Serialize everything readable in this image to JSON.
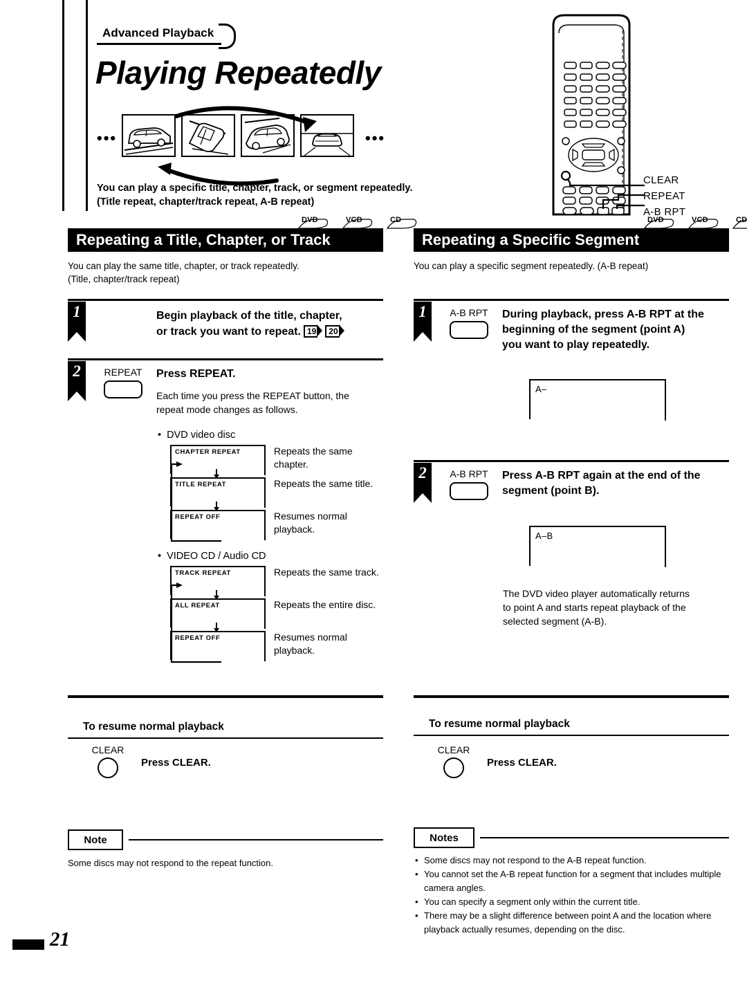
{
  "document": {
    "chapter_tab": "Advanced Playback",
    "title": "Playing Repeatedly",
    "intro_line1": "You can play a specific title, chapter, track, or segment repeatedly.",
    "intro_line2": "(Title repeat, chapter/track repeat, A-B repeat)",
    "page_number": "21"
  },
  "remote": {
    "callouts": [
      {
        "label": "CLEAR"
      },
      {
        "label": "REPEAT"
      },
      {
        "label": "A-B RPT"
      }
    ]
  },
  "media_badges": [
    "DVD",
    "VCD",
    "CD"
  ],
  "left_column": {
    "header": "Repeating a Title, Chapter, or Track",
    "sub_line1": "You can play the same title, chapter, or track repeatedly.",
    "sub_line2": "(Title, chapter/track repeat)",
    "step1": {
      "number": "1",
      "heading_line1": "Begin playback of the title, chapter,",
      "heading_line2": "or track you want to repeat.",
      "page_refs": [
        "19",
        "20"
      ]
    },
    "step2": {
      "number": "2",
      "button_caption": "REPEAT",
      "heading": "Press REPEAT.",
      "body_line1": "Each time you press the REPEAT button, the",
      "body_line2": "repeat mode changes as follows."
    },
    "flow_dvd": {
      "title": "DVD video disc",
      "rows": [
        {
          "display": "CHAPTER  REPEAT",
          "desc_line1": "Repeats the same",
          "desc_line2": "chapter."
        },
        {
          "display": "TITLE  REPEAT",
          "desc_line1": "Repeats the same title.",
          "desc_line2": ""
        },
        {
          "display": "REPEAT  OFF",
          "desc_line1": "Resumes normal",
          "desc_line2": "playback."
        }
      ]
    },
    "flow_cd": {
      "title": "VIDEO CD / Audio CD",
      "rows": [
        {
          "display": "TRACK  REPEAT",
          "desc_line1": "Repeats the same track.",
          "desc_line2": ""
        },
        {
          "display": "ALL  REPEAT",
          "desc_line1": "Repeats the entire disc.",
          "desc_line2": ""
        },
        {
          "display": "REPEAT  OFF",
          "desc_line1": "Resumes normal",
          "desc_line2": "playback."
        }
      ]
    },
    "resume": {
      "title": "To resume normal playback",
      "button_caption": "CLEAR",
      "instruction": "Press CLEAR."
    },
    "note": {
      "label": "Note",
      "text": "Some discs may not respond to the repeat function."
    }
  },
  "right_column": {
    "header": "Repeating a Specific Segment",
    "sub_line1": "You can play a specific segment repeatedly. (A-B repeat)",
    "step1": {
      "number": "1",
      "button_caption": "A-B RPT",
      "heading_line1": "During playback, press A-B RPT at the",
      "heading_line2": "beginning of the segment (point A)",
      "heading_line3": "you want to play repeatedly."
    },
    "osd_a": "A–",
    "step2": {
      "number": "2",
      "button_caption": "A-B RPT",
      "heading_line1": "Press A-B RPT again at the end of the",
      "heading_line2": "segment (point B)."
    },
    "osd_ab": "A–B",
    "after_text_line1": "The DVD video player automatically returns",
    "after_text_line2": "to point A and starts repeat playback of the",
    "after_text_line3": "selected segment (A-B).",
    "resume": {
      "title": "To resume normal playback",
      "button_caption": "CLEAR",
      "instruction": "Press CLEAR."
    },
    "notes": {
      "label": "Notes",
      "items": [
        "Some discs may not respond to the A-B repeat function.",
        "You cannot set the A-B repeat function for a segment that includes multiple camera angles.",
        "You can specify a segment only within the current title.",
        "There may be a slight difference between point A and the location where playback actually resumes, depending on the disc."
      ]
    }
  }
}
